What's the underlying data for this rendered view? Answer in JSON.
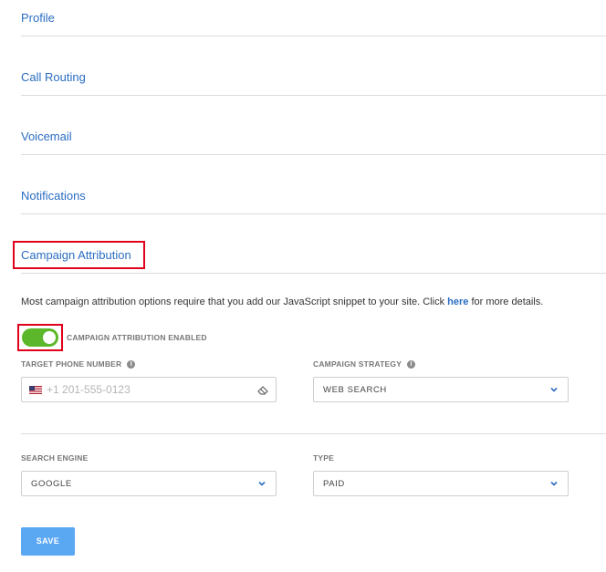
{
  "sections": [
    {
      "label": "Profile"
    },
    {
      "label": "Call Routing"
    },
    {
      "label": "Voicemail"
    },
    {
      "label": "Notifications"
    },
    {
      "label": "Campaign Attribution"
    }
  ],
  "description": {
    "before": "Most campaign attribution options require that you add our JavaScript snippet to your site. Click ",
    "link": "here",
    "after": " for more details."
  },
  "toggle": {
    "label": "CAMPAIGN ATTRIBUTION ENABLED",
    "enabled": true
  },
  "target_phone": {
    "label": "TARGET PHONE NUMBER",
    "placeholder": "+1 201-555-0123"
  },
  "campaign_strategy": {
    "label": "CAMPAIGN STRATEGY",
    "value": "WEB SEARCH"
  },
  "search_engine": {
    "label": "SEARCH ENGINE",
    "value": "GOOGLE"
  },
  "type": {
    "label": "TYPE",
    "value": "PAID"
  },
  "save": {
    "label": "SAVE"
  },
  "colors": {
    "link": "#2a6dc2",
    "toggle_on": "#5cb82a",
    "highlight": "#e0001b",
    "save_button": "#5aa7f2"
  }
}
